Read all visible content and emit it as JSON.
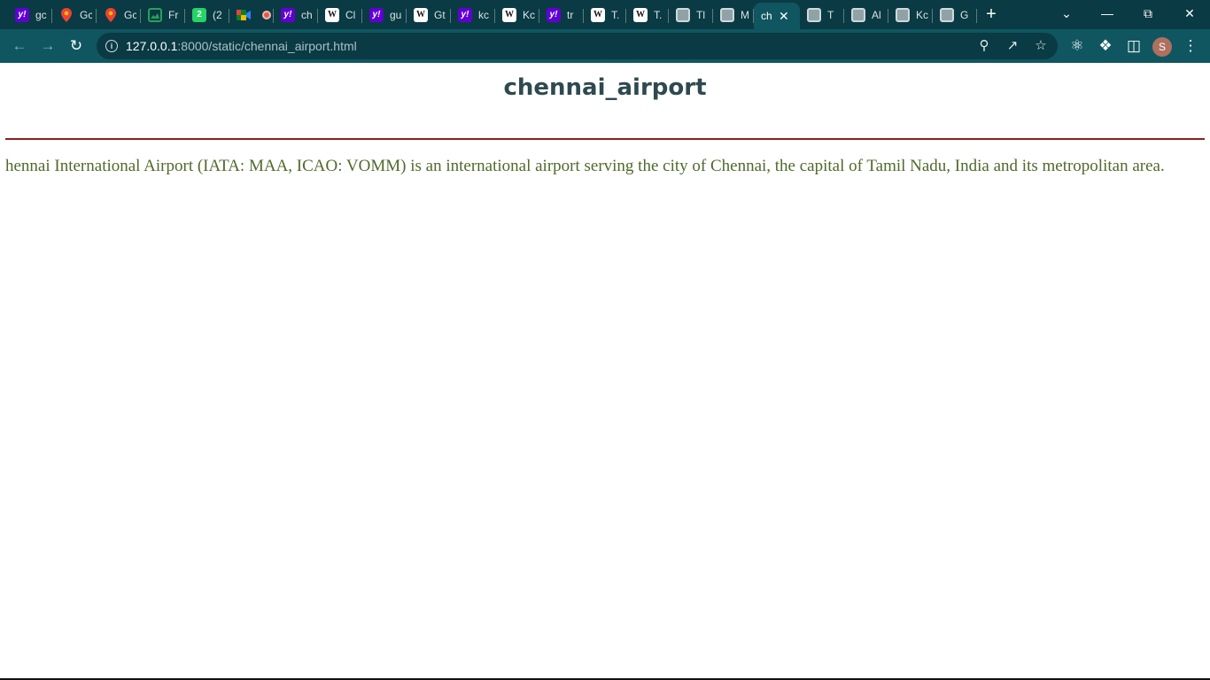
{
  "browser": {
    "tabs": [
      {
        "favicon": "yahoo-icon",
        "glyph": "y!",
        "title": "gc"
      },
      {
        "favicon": "google-maps-icon",
        "glyph": "",
        "title": "Gc"
      },
      {
        "favicon": "google-maps-icon",
        "glyph": "",
        "title": "Gc"
      },
      {
        "favicon": "image-icon",
        "glyph": "",
        "title": "Fr"
      },
      {
        "favicon": "whatsapp-icon",
        "glyph": "2",
        "title": "(2"
      },
      {
        "favicon": "google-meet-icon",
        "glyph": "",
        "title": ""
      },
      {
        "favicon": "yahoo-icon",
        "glyph": "y!",
        "title": "ch"
      },
      {
        "favicon": "wikipedia-icon",
        "glyph": "W",
        "title": "Cl"
      },
      {
        "favicon": "yahoo-icon",
        "glyph": "y!",
        "title": "gu"
      },
      {
        "favicon": "wikipedia-icon",
        "glyph": "W",
        "title": "Gt"
      },
      {
        "favicon": "yahoo-icon",
        "glyph": "y!",
        "title": "kc"
      },
      {
        "favicon": "wikipedia-icon",
        "glyph": "W",
        "title": "Kc"
      },
      {
        "favicon": "yahoo-icon",
        "glyph": "y!",
        "title": "tr"
      },
      {
        "favicon": "wikipedia-icon",
        "glyph": "W",
        "title": "T."
      },
      {
        "favicon": "wikipedia-icon",
        "glyph": "W",
        "title": "T."
      },
      {
        "favicon": "globe-icon",
        "glyph": "",
        "title": "Tl"
      },
      {
        "favicon": "globe-icon",
        "glyph": "",
        "title": "M"
      },
      {
        "favicon": "",
        "glyph": "",
        "title": "ch",
        "active": true
      },
      {
        "favicon": "globe-icon",
        "glyph": "",
        "title": "T"
      },
      {
        "favicon": "globe-icon",
        "glyph": "",
        "title": "Al"
      },
      {
        "favicon": "globe-icon",
        "glyph": "",
        "title": "Kc"
      },
      {
        "favicon": "globe-icon",
        "glyph": "",
        "title": "G"
      }
    ],
    "url_host": "127.0.0.1",
    "url_rest": ":8000/static/chennai_airport.html",
    "avatar_initial": "S",
    "theme_color": "#0f5660"
  },
  "page": {
    "title": "chennai_airport",
    "paragraph": "hennai International Airport (IATA: MAA, ICAO: VOMM) is an international airport serving the city of Chennai, the capital of Tamil Nadu, India and its metropolitan area.",
    "title_color": "#2e4a50",
    "rule_color": "#8b2020",
    "text_color": "#4f6a2a"
  }
}
